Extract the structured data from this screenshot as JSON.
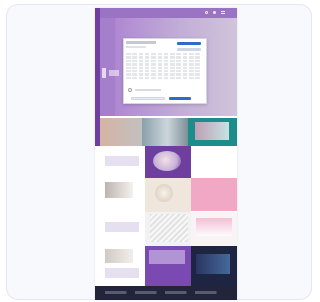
{
  "page": {
    "colors": {
      "purple": "#a57fcc",
      "deep_purple": "#6f3f9f",
      "pink": "#f1a8c4",
      "teal": "#1c8d8a",
      "navy": "#1d2543",
      "blue_button": "#2f6cc9",
      "footer": "#22253a"
    }
  },
  "header": {
    "title": "",
    "nav_icons": [
      "search-icon",
      "user-icon",
      "menu-icon"
    ]
  },
  "hero": {
    "side_label": "",
    "headline": ""
  },
  "cookie_dialog": {
    "title": "",
    "subtitle": "",
    "button_primary": "",
    "button_secondary": "",
    "link_text": "",
    "grid_rows": 8,
    "grid_cols": 12
  },
  "articles": [
    {
      "category": "",
      "title": "",
      "color": "#6f3f9f"
    },
    {
      "category": "",
      "title": "",
      "color": "#f1a8c4"
    },
    {
      "category": "",
      "title": "",
      "color": "#ffffff"
    },
    {
      "category": "",
      "title": "",
      "color": "#1d2543"
    }
  ],
  "footer": {
    "links": []
  }
}
